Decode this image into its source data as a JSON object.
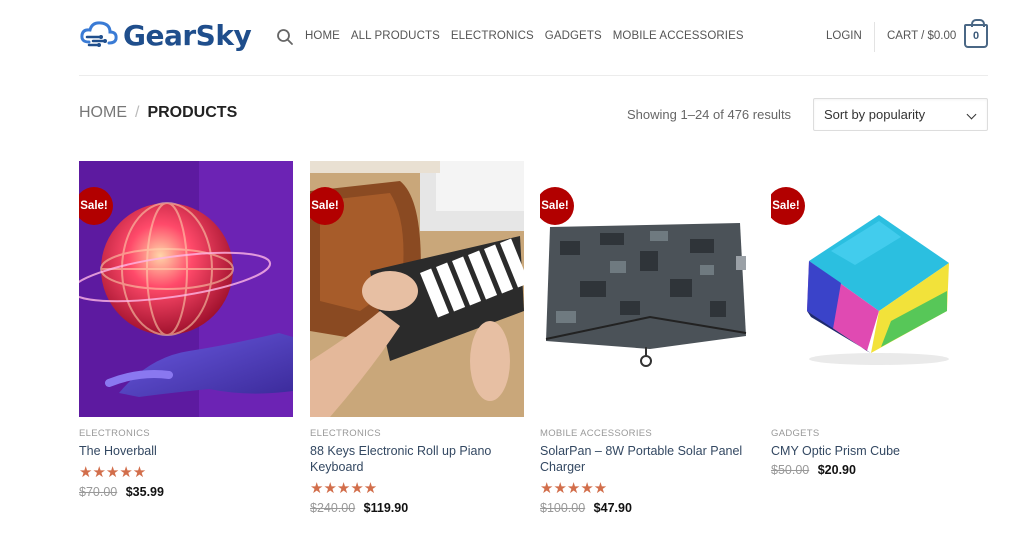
{
  "brand": {
    "name": "GearSky"
  },
  "nav": {
    "items": [
      "Home",
      "All Products",
      "Electronics",
      "Gadgets",
      "Mobile Accessories"
    ]
  },
  "header": {
    "login": "LOGIN",
    "cart_label": "CART / $0.00",
    "cart_count": "0"
  },
  "breadcrumb": {
    "home": "HOME",
    "separator": "/",
    "current": "PRODUCTS"
  },
  "results": "Showing 1–24 of 476 results",
  "sort": {
    "selected": "Sort by popularity"
  },
  "colors": {
    "brand": "#1f4e8c",
    "sale_badge": "#b20000",
    "stars": "#d26e4b",
    "link": "#334862"
  },
  "products": [
    {
      "badge": "Sale!",
      "category": "ELECTRONICS",
      "title": "The Hoverball",
      "rating": 5,
      "old_price": "$70.00",
      "price": "$35.99"
    },
    {
      "badge": "Sale!",
      "category": "ELECTRONICS",
      "title": "88 Keys Electronic Roll up Piano Keyboard",
      "rating": 5,
      "old_price": "$240.00",
      "price": "$119.90"
    },
    {
      "badge": "Sale!",
      "category": "MOBILE ACCESSORIES",
      "title": "SolarPan – 8W Portable Solar Panel Charger",
      "rating": 5,
      "old_price": "$100.00",
      "price": "$47.90"
    },
    {
      "badge": "Sale!",
      "category": "GADGETS",
      "title": "CMY Optic Prism Cube",
      "rating": null,
      "old_price": "$50.00",
      "price": "$20.90"
    }
  ]
}
